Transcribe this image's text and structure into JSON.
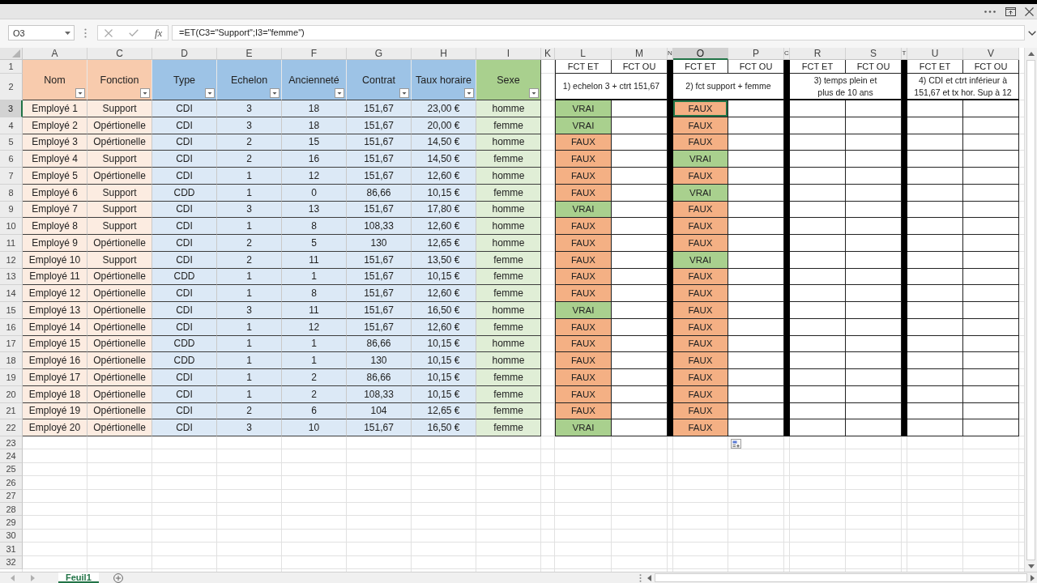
{
  "formula_bar": {
    "name_box": "O3",
    "function_button": "fx",
    "formula": "=ET(C3=\"Support\";I3=\"femme\")"
  },
  "column_headers": [
    {
      "label": "A",
      "selected": false
    },
    {
      "label": "C",
      "selected": false
    },
    {
      "label": "D",
      "selected": false
    },
    {
      "label": "E",
      "selected": false
    },
    {
      "label": "F",
      "selected": false
    },
    {
      "label": "G",
      "selected": false
    },
    {
      "label": "H",
      "selected": false
    },
    {
      "label": "I",
      "selected": false
    },
    {
      "label": "K",
      "selected": false
    },
    {
      "label": "L",
      "selected": false
    },
    {
      "label": "M",
      "selected": false
    },
    {
      "label": "N",
      "selected": false
    },
    {
      "label": "O",
      "selected": true
    },
    {
      "label": "P",
      "selected": false
    },
    {
      "label": "C",
      "selected": false
    },
    {
      "label": "R",
      "selected": false
    },
    {
      "label": "S",
      "selected": false
    },
    {
      "label": "T",
      "selected": false
    },
    {
      "label": "U",
      "selected": false
    },
    {
      "label": "V",
      "selected": false
    }
  ],
  "row_headers": [
    {
      "label": "1",
      "selected": false
    },
    {
      "label": "2",
      "selected": false
    },
    {
      "label": "3",
      "selected": true
    },
    {
      "label": "4",
      "selected": false
    },
    {
      "label": "5",
      "selected": false
    },
    {
      "label": "6",
      "selected": false
    },
    {
      "label": "7",
      "selected": false
    },
    {
      "label": "8",
      "selected": false
    },
    {
      "label": "9",
      "selected": false
    },
    {
      "label": "10",
      "selected": false
    },
    {
      "label": "11",
      "selected": false
    },
    {
      "label": "12",
      "selected": false
    },
    {
      "label": "13",
      "selected": false
    },
    {
      "label": "14",
      "selected": false
    },
    {
      "label": "15",
      "selected": false
    },
    {
      "label": "16",
      "selected": false
    },
    {
      "label": "17",
      "selected": false
    },
    {
      "label": "18",
      "selected": false
    },
    {
      "label": "19",
      "selected": false
    },
    {
      "label": "20",
      "selected": false
    },
    {
      "label": "21",
      "selected": false
    },
    {
      "label": "22",
      "selected": false
    },
    {
      "label": "23",
      "selected": false
    },
    {
      "label": "24",
      "selected": false
    },
    {
      "label": "25",
      "selected": false
    },
    {
      "label": "26",
      "selected": false
    },
    {
      "label": "27",
      "selected": false
    },
    {
      "label": "28",
      "selected": false
    },
    {
      "label": "29",
      "selected": false
    },
    {
      "label": "30",
      "selected": false
    },
    {
      "label": "31",
      "selected": false
    },
    {
      "label": "32",
      "selected": false
    }
  ],
  "table": {
    "columns": [
      {
        "label": "Nom",
        "color": "#f8cbad"
      },
      {
        "label": "Fonction",
        "color": "#f8cbad"
      },
      {
        "label": "Type",
        "color": "#9dc3e6"
      },
      {
        "label": "Echelon",
        "color": "#9dc3e6"
      },
      {
        "label": "Ancienneté",
        "color": "#9dc3e6"
      },
      {
        "label": "Contrat",
        "color": "#9dc3e6"
      },
      {
        "label": "Taux horaire",
        "color": "#9dc3e6"
      },
      {
        "label": "Sexe",
        "color": "#a9d08e"
      }
    ],
    "rows": [
      [
        "Employé 1",
        "Support",
        "CDI",
        "3",
        "18",
        "151,67",
        "23,00 €",
        "homme"
      ],
      [
        "Employé 2",
        "Opértionelle",
        "CDI",
        "3",
        "18",
        "151,67",
        "20,00 €",
        "femme"
      ],
      [
        "Employé 3",
        "Opértionelle",
        "CDI",
        "2",
        "15",
        "151,67",
        "14,50 €",
        "homme"
      ],
      [
        "Employé 4",
        "Support",
        "CDI",
        "2",
        "16",
        "151,67",
        "14,50 €",
        "femme"
      ],
      [
        "Employé 5",
        "Opértionelle",
        "CDI",
        "1",
        "12",
        "151,67",
        "12,60 €",
        "homme"
      ],
      [
        "Employé 6",
        "Support",
        "CDD",
        "1",
        "0",
        "86,66",
        "10,15 €",
        "femme"
      ],
      [
        "Employé 7",
        "Support",
        "CDI",
        "3",
        "13",
        "151,67",
        "17,80 €",
        "homme"
      ],
      [
        "Employé 8",
        "Support",
        "CDI",
        "1",
        "8",
        "108,33",
        "12,60 €",
        "homme"
      ],
      [
        "Employé 9",
        "Opértionelle",
        "CDI",
        "2",
        "5",
        "130",
        "12,65 €",
        "homme"
      ],
      [
        "Employé 10",
        "Support",
        "CDI",
        "2",
        "11",
        "151,67",
        "13,50 €",
        "femme"
      ],
      [
        "Employé 11",
        "Opértionelle",
        "CDD",
        "1",
        "1",
        "151,67",
        "10,15 €",
        "femme"
      ],
      [
        "Employé 12",
        "Opértionelle",
        "CDI",
        "1",
        "8",
        "151,67",
        "12,60 €",
        "femme"
      ],
      [
        "Employé 13",
        "Opértionelle",
        "CDI",
        "3",
        "11",
        "151,67",
        "16,50 €",
        "homme"
      ],
      [
        "Employé 14",
        "Opértionelle",
        "CDI",
        "1",
        "12",
        "151,67",
        "12,60 €",
        "femme"
      ],
      [
        "Employé 15",
        "Opértionelle",
        "CDD",
        "1",
        "1",
        "86,66",
        "10,15 €",
        "homme"
      ],
      [
        "Employé 16",
        "Opértionelle",
        "CDD",
        "1",
        "1",
        "130",
        "10,15 €",
        "homme"
      ],
      [
        "Employé 17",
        "Opértionelle",
        "CDI",
        "1",
        "2",
        "86,66",
        "10,15 €",
        "femme"
      ],
      [
        "Employé 18",
        "Opértionelle",
        "CDI",
        "1",
        "2",
        "108,33",
        "10,15 €",
        "femme"
      ],
      [
        "Employé 19",
        "Opértionelle",
        "CDI",
        "2",
        "6",
        "104",
        "12,65 €",
        "femme"
      ],
      [
        "Employé 20",
        "Opértionelle",
        "CDI",
        "3",
        "10",
        "151,67",
        "16,50 €",
        "femme"
      ]
    ]
  },
  "checks": [
    {
      "headers": [
        "FCT ET",
        "FCT OU"
      ],
      "description": "1) echelon 3 + ctrt 151,67",
      "results": [
        {
          "value": "VRAI",
          "color": "#a9d08e",
          "selected": false
        },
        {
          "value": "VRAI",
          "color": "#a9d08e",
          "selected": false
        },
        {
          "value": "FAUX",
          "color": "#f4b084",
          "selected": false
        },
        {
          "value": "FAUX",
          "color": "#f4b084",
          "selected": false
        },
        {
          "value": "FAUX",
          "color": "#f4b084",
          "selected": false
        },
        {
          "value": "FAUX",
          "color": "#f4b084",
          "selected": false
        },
        {
          "value": "VRAI",
          "color": "#a9d08e",
          "selected": false
        },
        {
          "value": "FAUX",
          "color": "#f4b084",
          "selected": false
        },
        {
          "value": "FAUX",
          "color": "#f4b084",
          "selected": false
        },
        {
          "value": "FAUX",
          "color": "#f4b084",
          "selected": false
        },
        {
          "value": "FAUX",
          "color": "#f4b084",
          "selected": false
        },
        {
          "value": "FAUX",
          "color": "#f4b084",
          "selected": false
        },
        {
          "value": "VRAI",
          "color": "#a9d08e",
          "selected": false
        },
        {
          "value": "FAUX",
          "color": "#f4b084",
          "selected": false
        },
        {
          "value": "FAUX",
          "color": "#f4b084",
          "selected": false
        },
        {
          "value": "FAUX",
          "color": "#f4b084",
          "selected": false
        },
        {
          "value": "FAUX",
          "color": "#f4b084",
          "selected": false
        },
        {
          "value": "FAUX",
          "color": "#f4b084",
          "selected": false
        },
        {
          "value": "FAUX",
          "color": "#f4b084",
          "selected": false
        },
        {
          "value": "VRAI",
          "color": "#a9d08e",
          "selected": false
        }
      ]
    },
    {
      "headers": [
        "FCT ET",
        "FCT OU"
      ],
      "description": "2) fct support + femme",
      "results": [
        {
          "value": "FAUX",
          "color": "#f4b084",
          "selected": true
        },
        {
          "value": "FAUX",
          "color": "#f4b084",
          "selected": false
        },
        {
          "value": "FAUX",
          "color": "#f4b084",
          "selected": false
        },
        {
          "value": "VRAI",
          "color": "#a9d08e",
          "selected": false
        },
        {
          "value": "FAUX",
          "color": "#f4b084",
          "selected": false
        },
        {
          "value": "VRAI",
          "color": "#a9d08e",
          "selected": false
        },
        {
          "value": "FAUX",
          "color": "#f4b084",
          "selected": false
        },
        {
          "value": "FAUX",
          "color": "#f4b084",
          "selected": false
        },
        {
          "value": "FAUX",
          "color": "#f4b084",
          "selected": false
        },
        {
          "value": "VRAI",
          "color": "#a9d08e",
          "selected": false
        },
        {
          "value": "FAUX",
          "color": "#f4b084",
          "selected": false
        },
        {
          "value": "FAUX",
          "color": "#f4b084",
          "selected": false
        },
        {
          "value": "FAUX",
          "color": "#f4b084",
          "selected": false
        },
        {
          "value": "FAUX",
          "color": "#f4b084",
          "selected": false
        },
        {
          "value": "FAUX",
          "color": "#f4b084",
          "selected": false
        },
        {
          "value": "FAUX",
          "color": "#f4b084",
          "selected": false
        },
        {
          "value": "FAUX",
          "color": "#f4b084",
          "selected": false
        },
        {
          "value": "FAUX",
          "color": "#f4b084",
          "selected": false
        },
        {
          "value": "FAUX",
          "color": "#f4b084",
          "selected": false
        },
        {
          "value": "FAUX",
          "color": "#f4b084",
          "selected": false
        }
      ]
    },
    {
      "headers": [
        "FCT ET",
        "FCT OU"
      ],
      "description": "3) temps plein et\nplus de 10 ans"
    },
    {
      "headers": [
        "FCT ET",
        "FCT OU"
      ],
      "description": "4) CDI et ctrt inférieur à\n151,67 et tx hor. Sup à 12"
    }
  ],
  "sheet_tabs": [
    {
      "label": "Feuil1",
      "selected": true
    }
  ]
}
